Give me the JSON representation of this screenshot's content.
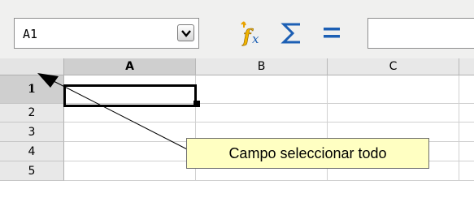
{
  "toolbar": {
    "name_box_value": "A1",
    "formula_value": "",
    "icons": [
      "dropdown-arrow-icon",
      "function-wizard-icon",
      "sum-icon",
      "equals-icon"
    ]
  },
  "grid": {
    "columns": [
      "A",
      "B",
      "C"
    ],
    "rows": [
      "1",
      "2",
      "3",
      "4",
      "5"
    ],
    "active_cell": "A1"
  },
  "callout": {
    "text": "Campo seleccionar todo"
  },
  "colors": {
    "toolbar_bg": "#f0f0ef",
    "header_bg": "#e8e8e8",
    "active_header_bg": "#cfcfcf",
    "callout_bg": "#ffffc2",
    "sum_icon": "#1c5fb4",
    "fx_icon": "#e8a200"
  }
}
